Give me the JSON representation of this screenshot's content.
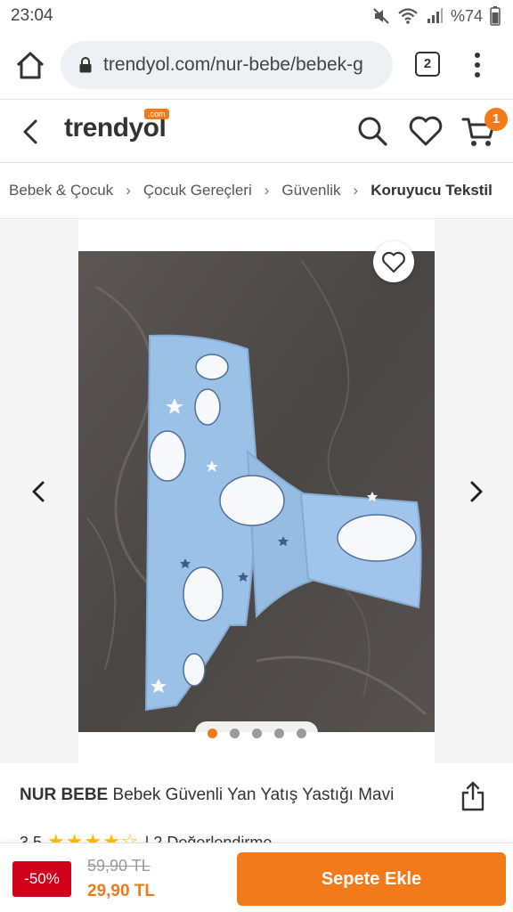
{
  "status_bar": {
    "time": "23:04",
    "battery": "%74",
    "icons": [
      "mute-icon",
      "wifi-icon",
      "signal-icon",
      "battery-icon"
    ]
  },
  "browser": {
    "url": "trendyol.com/nur-bebe/bebek-g",
    "tab_count": "2",
    "icons": [
      "home-icon",
      "lock-icon",
      "tabs-icon",
      "more-vert-icon"
    ]
  },
  "app_header": {
    "logo": "trendyol",
    "logo_badge": ".com",
    "cart_count": "1",
    "icons": [
      "back-arrow-icon",
      "search-icon",
      "heart-icon",
      "cart-icon"
    ]
  },
  "breadcrumb": {
    "items": [
      "Bebek & Çocuk",
      "Çocuk Gereçleri",
      "Güvenlik",
      "Koruyucu Tekstil"
    ]
  },
  "gallery": {
    "image_count": 5,
    "active_index": 0,
    "icons": [
      "heart-outline-icon",
      "chevron-left-icon",
      "chevron-right-icon"
    ]
  },
  "product": {
    "brand": "NUR BEBE",
    "name": "Bebek Güvenli Yan Yatış Yastığı Mavi",
    "rating": "3.5",
    "rating_value": 3.5,
    "review_text": "| 2 Değerlendirme"
  },
  "purchase": {
    "discount": "-50%",
    "old_price": "59,90 TL",
    "new_price": "29,90 TL",
    "button_label": "Sepete Ekle"
  },
  "colors": {
    "accent": "#f27a1a",
    "discount_red": "#d0021b",
    "star": "#ffc000",
    "pillow_blue": "#9cc1e6"
  }
}
